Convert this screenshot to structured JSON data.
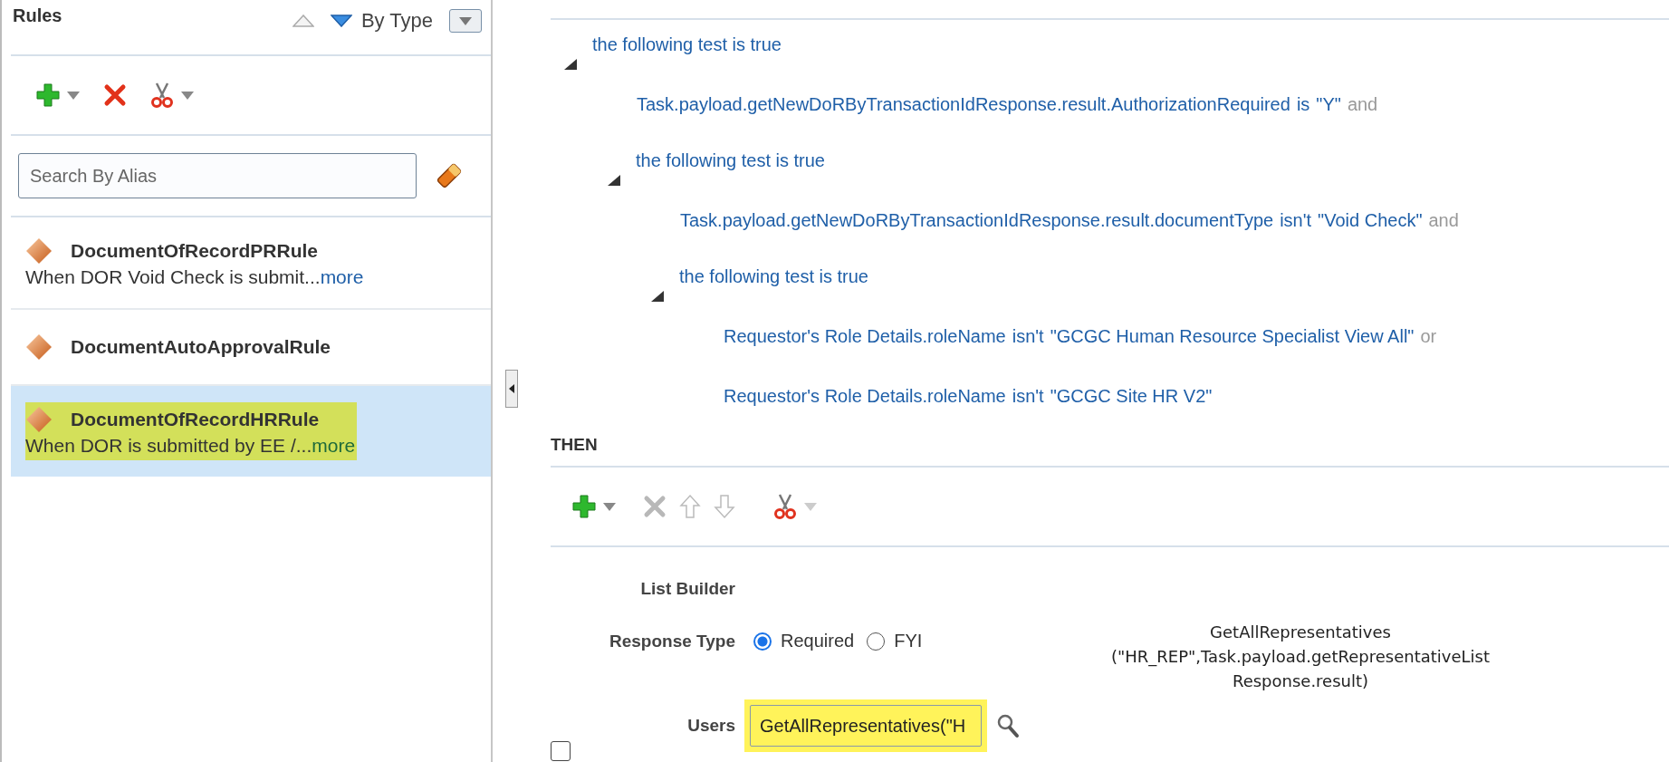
{
  "rules_panel": {
    "title": "Rules",
    "sort_buttons": [
      {
        "kind": "ascending",
        "selected": false
      },
      {
        "kind": "descending",
        "selected": true
      }
    ],
    "group_by": "By Type",
    "search": {
      "placeholder": "Search By Alias"
    },
    "rules": [
      {
        "name": "DocumentOfRecordPRRule",
        "description": "When DOR Void Check is submit...",
        "more": "more",
        "selected": false,
        "highlighted": false
      },
      {
        "name": "DocumentAutoApprovalRule",
        "selected": false,
        "highlighted": false
      },
      {
        "name": "DocumentOfRecordHRRule",
        "description": "When DOR is submitted by EE /...",
        "more": "more",
        "selected": true,
        "highlighted": true
      }
    ]
  },
  "conditions": [
    {
      "kind": "group",
      "label": "the following test is true",
      "expanded": true,
      "children": [
        {
          "kind": "test",
          "subject": "Task.payload.getNewDoRByTransactionIdResponse.result.AuthorizationRequired",
          "operator": "is",
          "value": "\"Y\"",
          "connector": "and"
        },
        {
          "kind": "group",
          "label": "the following test is true",
          "expanded": true,
          "children": [
            {
              "kind": "test",
              "subject": "Task.payload.getNewDoRByTransactionIdResponse.result.documentType",
              "operator": "isn't",
              "value": "\"Void Check\"",
              "connector": "and"
            },
            {
              "kind": "group",
              "label": "the following test is true",
              "expanded": true,
              "children": [
                {
                  "kind": "test",
                  "subject": "Requestor's Role Details.roleName",
                  "operator": "isn't",
                  "value": "\"GCGC Human Resource Specialist View All\"",
                  "connector": "or"
                },
                {
                  "kind": "test",
                  "subject": "Requestor's Role Details.roleName",
                  "operator": "isn't",
                  "value": "\"GCGC Site HR V2\""
                }
              ]
            }
          ]
        }
      ]
    }
  ],
  "then": {
    "title": "THEN",
    "toolbar": [
      {
        "kind": "add",
        "disabled": false
      },
      {
        "kind": "delete",
        "disabled": true
      },
      {
        "kind": "move-up",
        "disabled": true
      },
      {
        "kind": "move-down",
        "disabled": true
      },
      {
        "kind": "cut",
        "disabled": false
      }
    ],
    "action": {
      "title": "List Builder",
      "response_type": {
        "label": "Response Type",
        "options": [
          {
            "label": "Required",
            "selected": true
          },
          {
            "label": "FYI",
            "selected": false
          }
        ]
      },
      "expression": "GetAllRepresentatives (\"HR_REP\",Task.payload.getRepresentativeListResponse.result)",
      "users": {
        "label": "Users",
        "value": "GetAllRepresentatives(\"H",
        "highlighted": true
      }
    },
    "select_checkbox": {
      "checked": false
    }
  }
}
